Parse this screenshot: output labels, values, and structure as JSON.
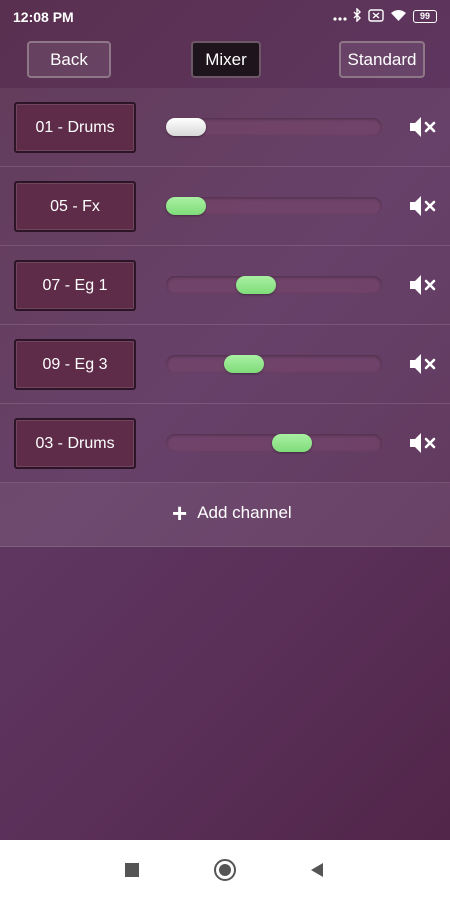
{
  "status_bar": {
    "time": "12:08 PM",
    "battery": "99",
    "icons": [
      "dots-icon",
      "bluetooth-icon",
      "battery-saver-icon",
      "wifi-icon",
      "battery-icon"
    ]
  },
  "toolbar": {
    "back_label": "Back",
    "mixer_label": "Mixer",
    "standard_label": "Standard"
  },
  "channels": [
    {
      "name": "01 - Drums",
      "volume": 0.0,
      "muted": true
    },
    {
      "name": "05 - Fx",
      "volume": 0.0,
      "muted": false
    },
    {
      "name": "07 - Eg 1",
      "volume": 0.4,
      "muted": false
    },
    {
      "name": "09 - Eg 3",
      "volume": 0.33,
      "muted": false
    },
    {
      "name": "03 - Drums",
      "volume": 0.6,
      "muted": false
    }
  ],
  "add_channel": {
    "label": "Add channel",
    "icon": "plus-icon"
  },
  "colors": {
    "slider_active": "#7fdc79",
    "slider_muted": "#ffffff",
    "background": "#5e3660"
  }
}
